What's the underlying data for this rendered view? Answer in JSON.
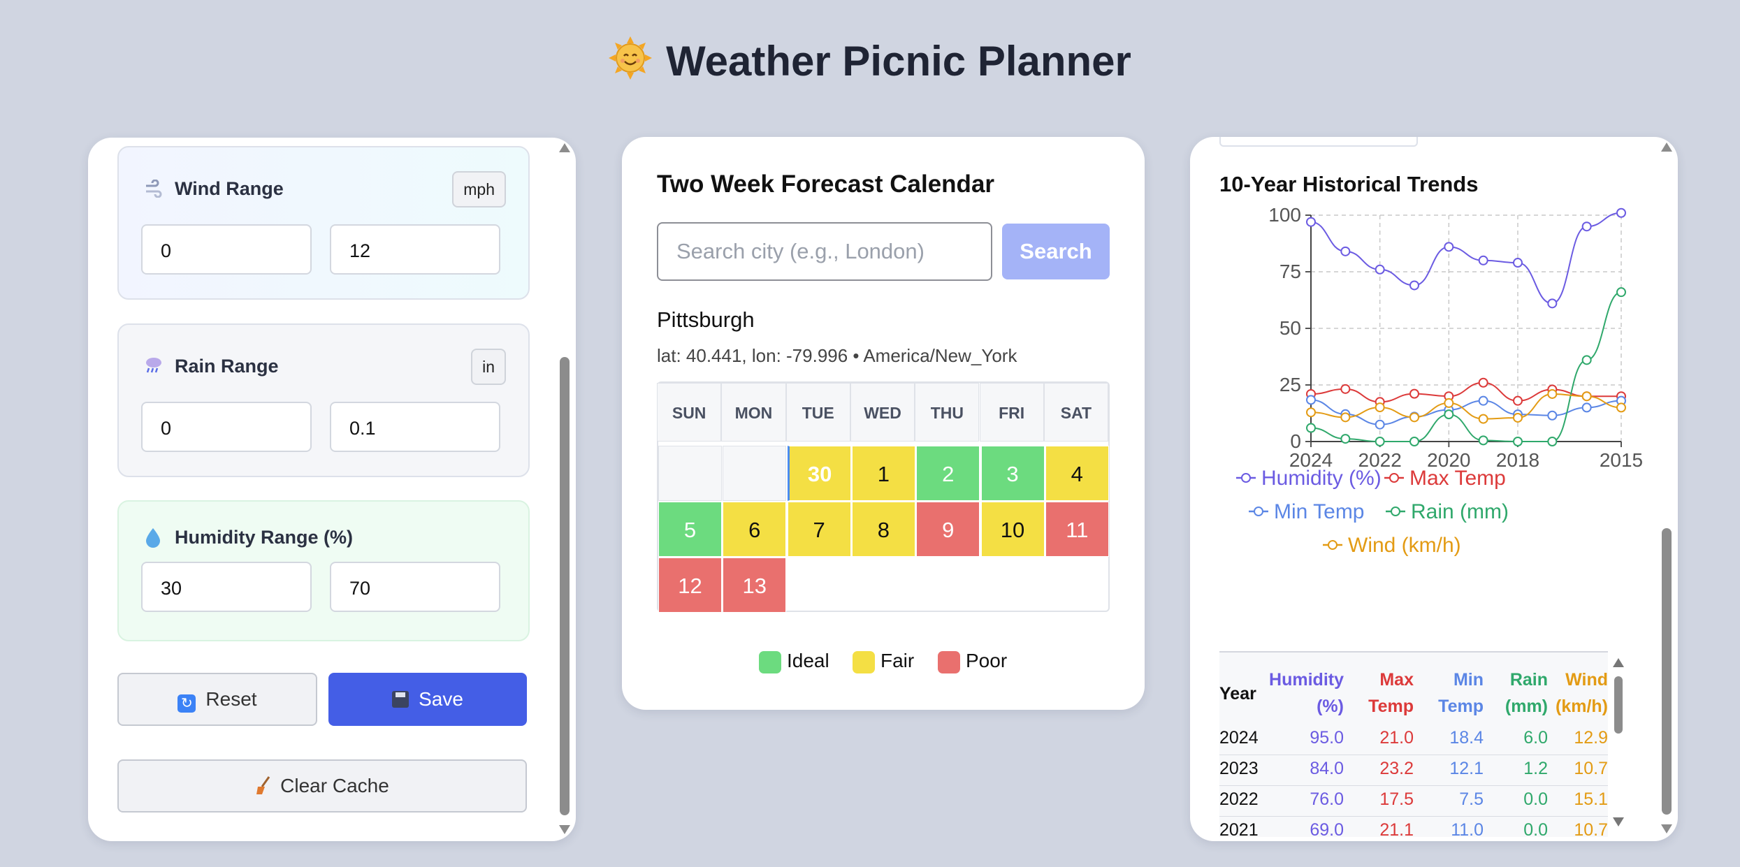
{
  "app": {
    "icon": "smiling-sun-icon",
    "title": "Weather Picnic Planner"
  },
  "settings": {
    "wind": {
      "label": "Wind Range",
      "icon": "wind-icon",
      "unit": "mph",
      "min": "0",
      "max": "12"
    },
    "rain": {
      "label": "Rain Range",
      "icon": "rain-cloud-icon",
      "unit": "in",
      "min": "0",
      "max": "0.1"
    },
    "humidity": {
      "label": "Humidity Range (%)",
      "icon": "droplet-icon",
      "min": "30",
      "max": "70"
    },
    "reset_label": "Reset",
    "save_label": "Save",
    "clear_cache_label": "Clear Cache"
  },
  "forecast": {
    "title": "Two Week Forecast Calendar",
    "search_placeholder": "Search city (e.g., London)",
    "search_label": "Search",
    "city": "Pittsburgh",
    "coords": "lat: 40.441, lon: -79.996 • America/New_York",
    "weekdays": [
      "SUN",
      "MON",
      "TUE",
      "WED",
      "THU",
      "FRI",
      "SAT"
    ],
    "days": [
      {
        "day": "30",
        "rating": "fair",
        "today": true
      },
      {
        "day": "1",
        "rating": "fair"
      },
      {
        "day": "2",
        "rating": "ideal"
      },
      {
        "day": "3",
        "rating": "ideal"
      },
      {
        "day": "4",
        "rating": "fair"
      },
      {
        "day": "5",
        "rating": "ideal"
      },
      {
        "day": "6",
        "rating": "fair"
      },
      {
        "day": "7",
        "rating": "fair"
      },
      {
        "day": "8",
        "rating": "fair"
      },
      {
        "day": "9",
        "rating": "poor"
      },
      {
        "day": "10",
        "rating": "fair"
      },
      {
        "day": "11",
        "rating": "poor"
      },
      {
        "day": "12",
        "rating": "poor"
      },
      {
        "day": "13",
        "rating": "poor"
      }
    ],
    "legend": [
      {
        "label": "Ideal",
        "color": "#6cdb7f"
      },
      {
        "label": "Fair",
        "color": "#f4df44"
      },
      {
        "label": "Poor",
        "color": "#e9706e"
      }
    ]
  },
  "history": {
    "title": "10-Year Historical Trends",
    "table_headers": [
      "Year",
      "Humidity (%)",
      "Max Temp",
      "Min Temp",
      "Rain (mm)",
      "Wind (km/h)"
    ],
    "table_rows": [
      [
        "2024",
        "95.0",
        "21.0",
        "18.4",
        "6.0",
        "12.9"
      ],
      [
        "2023",
        "84.0",
        "23.2",
        "12.1",
        "1.2",
        "10.7"
      ],
      [
        "2022",
        "76.0",
        "17.5",
        "7.5",
        "0.0",
        "15.1"
      ],
      [
        "2021",
        "69.0",
        "21.1",
        "11.0",
        "0.0",
        "10.7"
      ]
    ]
  },
  "chart_data": {
    "type": "line",
    "x": [
      "2024",
      "2023",
      "2022",
      "2021",
      "2020",
      "2019",
      "2018",
      "2017",
      "2016",
      "2015"
    ],
    "x_tick_labels": [
      "2024",
      "2022",
      "2020",
      "2018",
      "2015"
    ],
    "y_ticks": [
      "0",
      "25",
      "50",
      "75",
      "100"
    ],
    "ylim": [
      0,
      100
    ],
    "grid": true,
    "legend_position": "bottom",
    "series": [
      {
        "name": "Humidity (%)",
        "color": "#6b5be2",
        "values": [
          97,
          84,
          76,
          69,
          86,
          80,
          79,
          61,
          95,
          101
        ]
      },
      {
        "name": "Max Temp",
        "color": "#dc3a3a",
        "values": [
          21.0,
          23.2,
          17.5,
          21.1,
          20,
          26,
          18,
          23,
          20,
          20
        ]
      },
      {
        "name": "Min Temp",
        "color": "#5b86e5",
        "values": [
          18.4,
          12.1,
          7.5,
          11.0,
          14,
          18,
          12,
          11.5,
          15,
          18
        ]
      },
      {
        "name": "Rain (mm)",
        "color": "#2fa86b",
        "values": [
          6.0,
          1.2,
          0.0,
          0.0,
          12,
          0.5,
          0,
          0,
          36,
          66
        ]
      },
      {
        "name": "Wind (km/h)",
        "color": "#e39b14",
        "values": [
          12.9,
          10.7,
          15.1,
          10.7,
          17,
          10,
          10.5,
          21,
          20,
          15
        ]
      }
    ]
  }
}
